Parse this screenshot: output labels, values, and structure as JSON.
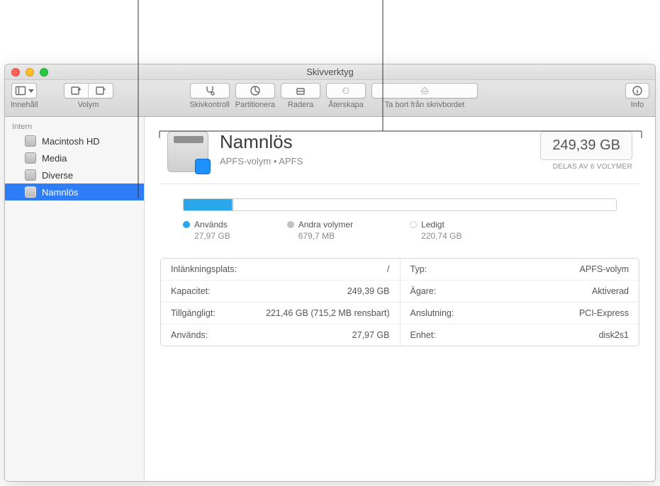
{
  "window": {
    "title": "Skivverktyg"
  },
  "toolbar": {
    "view_label": "Innehåll",
    "volume_label": "Volym",
    "first_aid_label": "Skivkontroll",
    "partition_label": "Partitionera",
    "erase_label": "Radera",
    "restore_label": "Återskapa",
    "unmount_label": "Ta bort från skrivbordet",
    "info_label": "Info"
  },
  "sidebar": {
    "section_label": "Intern",
    "items": [
      {
        "label": "Macintosh HD"
      },
      {
        "label": "Media"
      },
      {
        "label": "Diverse"
      },
      {
        "label": "Namnlös"
      }
    ]
  },
  "volume": {
    "name": "Namnlös",
    "subtitle": "APFS-volym • APFS",
    "size": "249,39 GB",
    "shared_note": "DELAS AV 6 VOLYMER"
  },
  "usage": {
    "used_pct": 11.2,
    "other_pct": 0.3,
    "legend": {
      "used_label": "Används",
      "used_value": "27,97 GB",
      "other_label": "Andra volymer",
      "other_value": "679,7 MB",
      "free_label": "Ledigt",
      "free_value": "220,74 GB"
    }
  },
  "details": {
    "left": [
      {
        "label": "Inlänkningsplats:",
        "value": "/"
      },
      {
        "label": "Kapacitet:",
        "value": "249,39 GB"
      },
      {
        "label": "Tillgängligt:",
        "value": "221,46 GB (715,2 MB rensbart)"
      },
      {
        "label": "Används:",
        "value": "27,97 GB"
      }
    ],
    "right": [
      {
        "label": "Typ:",
        "value": "APFS-volym"
      },
      {
        "label": "Ägare:",
        "value": "Aktiverad"
      },
      {
        "label": "Anslutning:",
        "value": "PCI-Express"
      },
      {
        "label": "Enhet:",
        "value": "disk2s1"
      }
    ]
  }
}
